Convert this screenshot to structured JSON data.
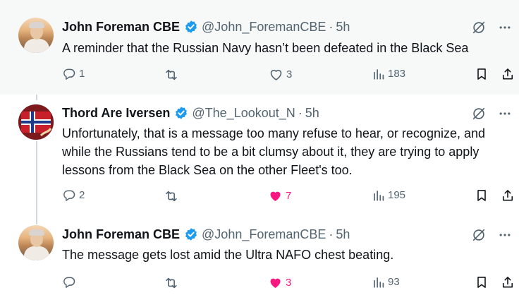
{
  "tweets": [
    {
      "name": "John Foreman CBE",
      "handle": "@John_ForemanCBE",
      "dot": "·",
      "time": "5h",
      "avatar": "john-foreman-avatar",
      "text": "A reminder that the Russian Navy hasn’t been defeated in the Black Sea",
      "replies": "1",
      "reposts": "",
      "likes": "3",
      "liked": false,
      "views": "183"
    },
    {
      "name": "Thord Are Iversen",
      "handle": "@The_Lookout_N",
      "dot": "·",
      "time": "5h",
      "avatar": "thord-avatar",
      "text": "Unfortunately, that is a message too many refuse to hear, or recognize, and while the Russians tend to be a bit clumsy about it, they are trying to apply lessons from the Black Sea on the other Fleet's too.",
      "replies": "2",
      "reposts": "",
      "likes": "7",
      "liked": true,
      "views": "195"
    },
    {
      "name": "John Foreman CBE",
      "handle": "@John_ForemanCBE",
      "dot": "·",
      "time": "5h",
      "avatar": "john-foreman-avatar",
      "text": "The message gets lost amid the Ultra NAFO chest beating.",
      "replies": "",
      "reposts": "",
      "likes": "3",
      "liked": true,
      "views": "93"
    }
  ],
  "icons": {
    "verified": "verified-badge-icon",
    "grok": "grok-icon",
    "more": "more-icon",
    "reply": "reply-icon",
    "repost": "repost-icon",
    "like": "heart-icon",
    "views": "views-icon",
    "bookmark": "bookmark-icon",
    "share": "share-icon"
  },
  "colors": {
    "verified": "#1d9bf0",
    "like_active": "#f91880",
    "muted": "#536471",
    "highlight_bg": "#f7f9f9",
    "thread_line": "#cfd9de"
  }
}
